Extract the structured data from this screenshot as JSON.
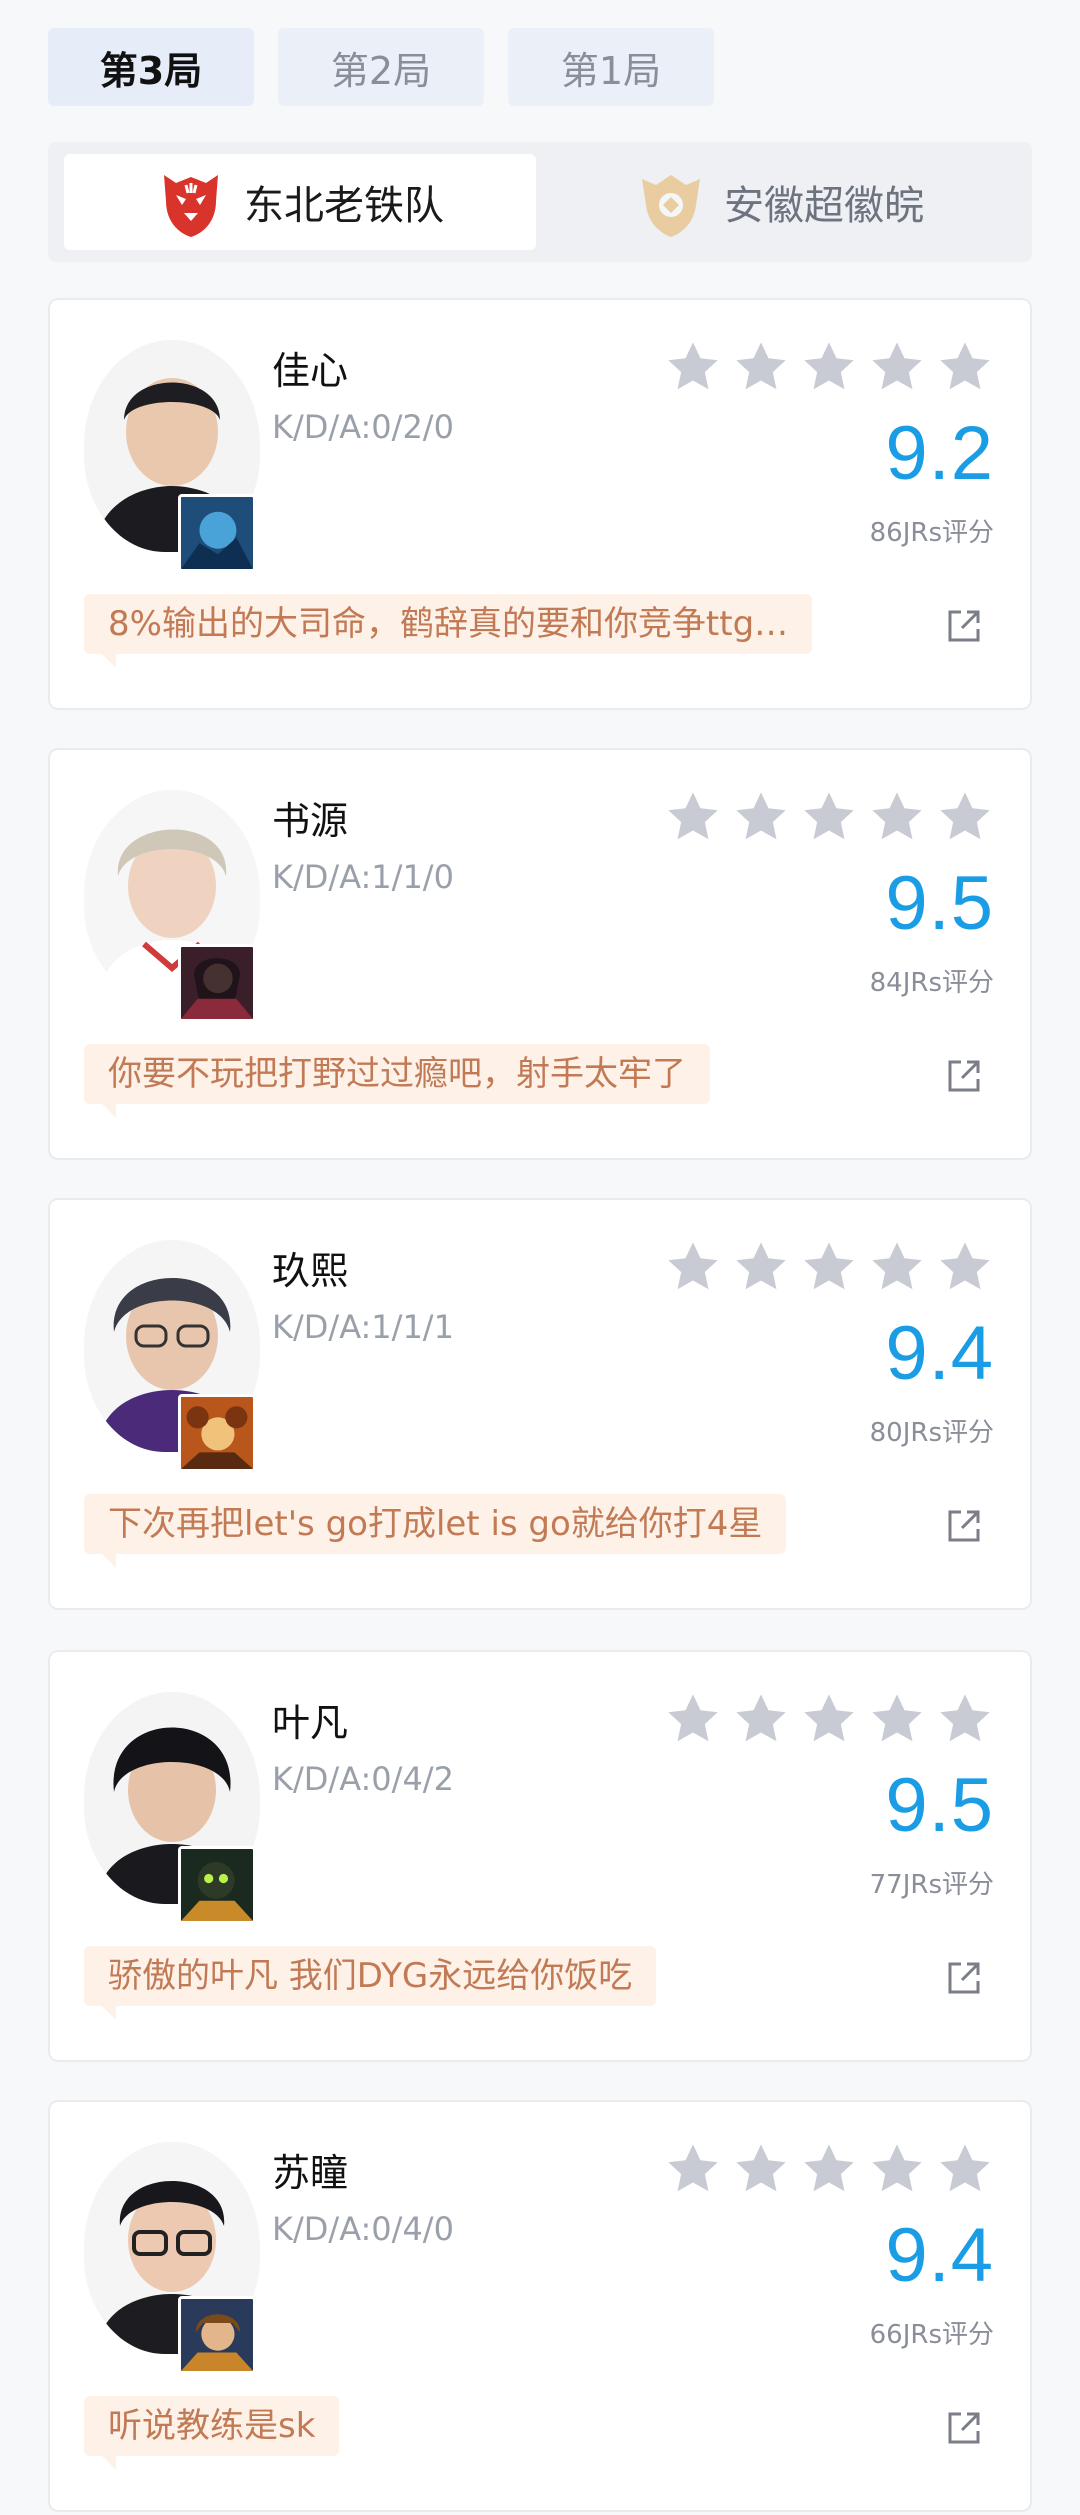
{
  "game_tabs": [
    {
      "label": "第3局",
      "active": true
    },
    {
      "label": "第2局",
      "active": false
    },
    {
      "label": "第1局",
      "active": false
    }
  ],
  "teams": {
    "left": {
      "name": "东北老铁队",
      "active": true,
      "logo_color": "#d9342b"
    },
    "right": {
      "name": "安徽超徽皖",
      "active": false,
      "logo_color": "#e3a33d"
    }
  },
  "colors": {
    "score": "#1a9de5",
    "star_inactive": "#c8cbd3",
    "comment_bg": "#fdf1e8",
    "comment_text": "#c27a55"
  },
  "players": [
    {
      "name": "佳心",
      "kda": "K/D/A:0/2/0",
      "score": "9.2",
      "votes": "86JRs评分",
      "comment": "8%输出的大司命，鹤辞真的要和你竞争ttg…",
      "stars_filled": 0,
      "hero_icon": "hero-blue-icon"
    },
    {
      "name": "书源",
      "kda": "K/D/A:1/1/0",
      "score": "9.5",
      "votes": "84JRs评分",
      "comment": "你要不玩把打野过过瘾吧，射手太牢了",
      "stars_filled": 0,
      "hero_icon": "hero-dark-icon"
    },
    {
      "name": "玖熙",
      "kda": "K/D/A:1/1/1",
      "score": "9.4",
      "votes": "80JRs评分",
      "comment": "下次再把let's go打成let is go就给你打4星",
      "stars_filled": 0,
      "hero_icon": "hero-orange-icon"
    },
    {
      "name": "叶凡",
      "kda": "K/D/A:0/4/2",
      "score": "9.5",
      "votes": "77JRs评分",
      "comment": "骄傲的叶凡 我们DYG永远给你饭吃",
      "stars_filled": 0,
      "hero_icon": "hero-green-icon"
    },
    {
      "name": "苏瞳",
      "kda": "K/D/A:0/4/0",
      "score": "9.4",
      "votes": "66JRs评分",
      "comment": "听说教练是sk",
      "stars_filled": 0,
      "hero_icon": "hero-brown-icon"
    }
  ]
}
